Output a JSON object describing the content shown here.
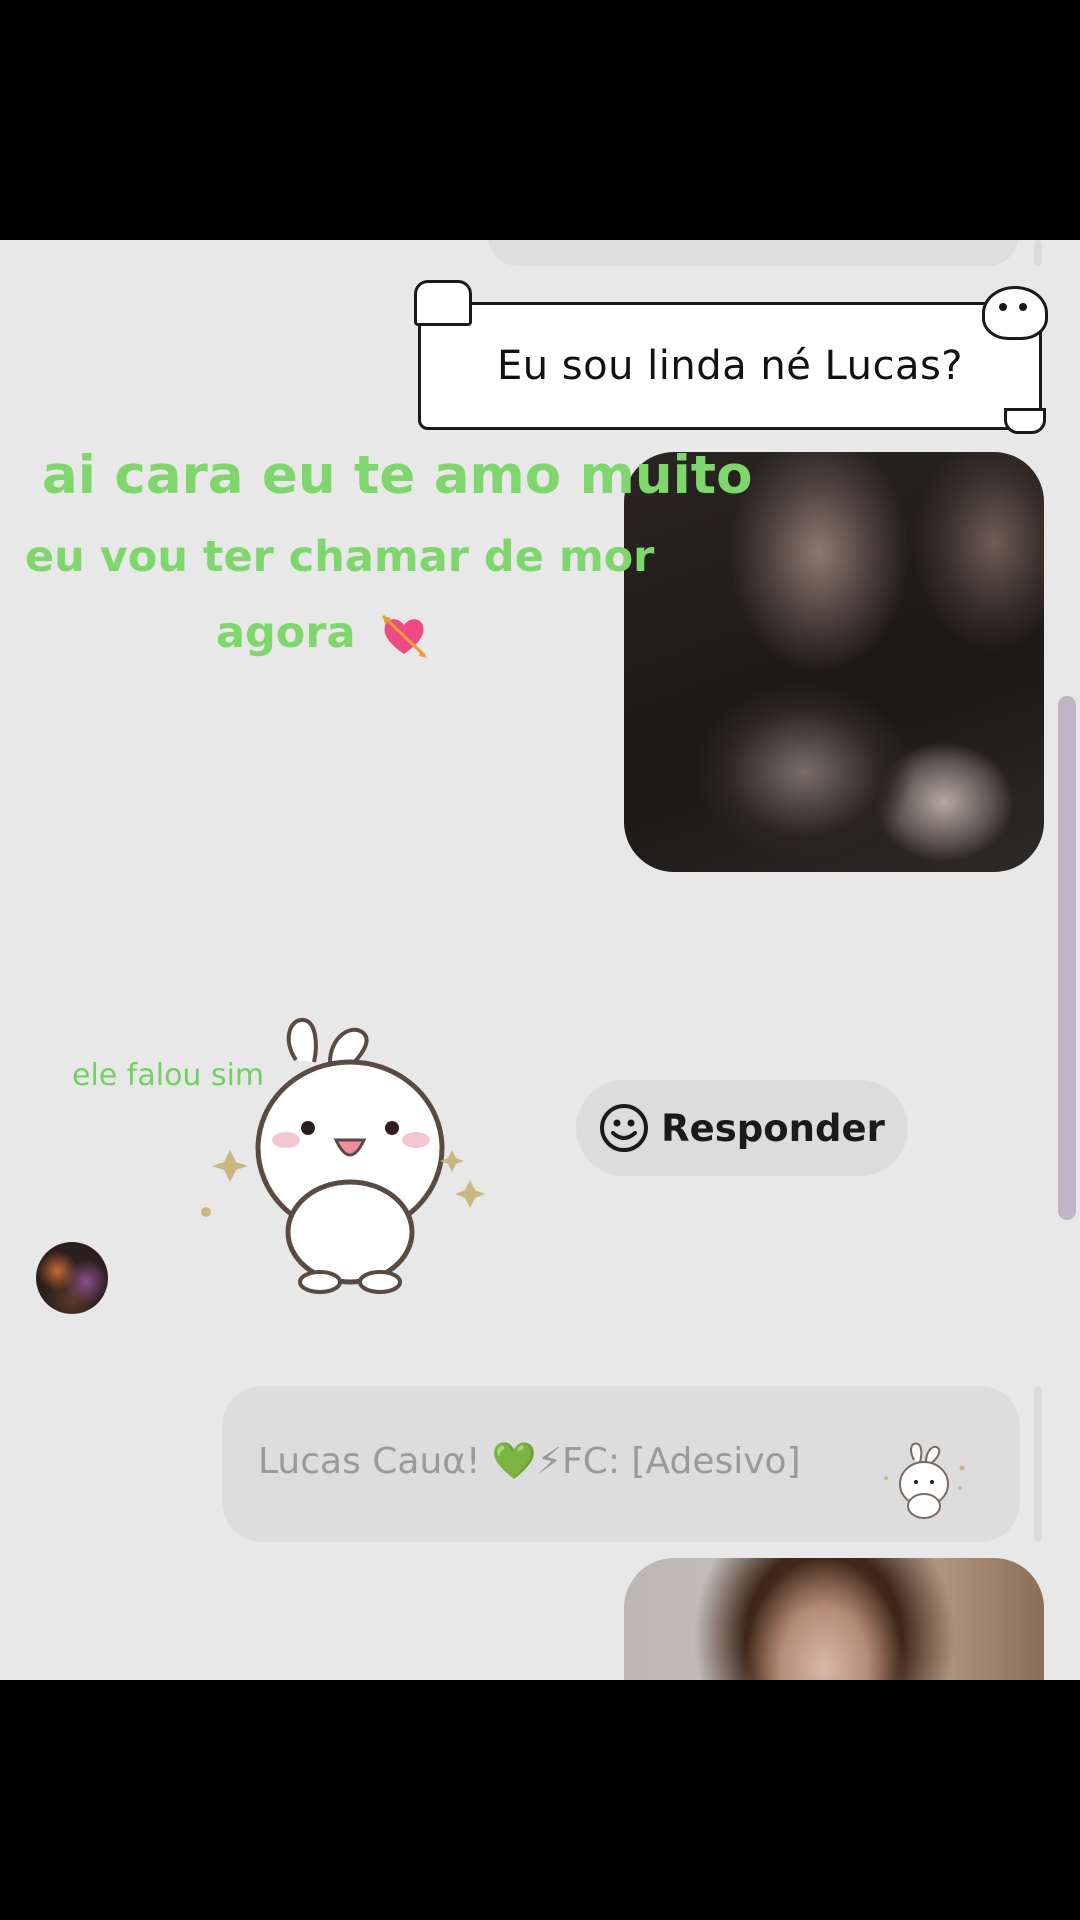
{
  "sticker_message": {
    "text": "Eu sou linda né Lucas?"
  },
  "captions": {
    "line1": "ai cara eu te amo muito",
    "line2": "eu vou ter chamar de mor",
    "line3": "agora",
    "line4": "ele falou sim"
  },
  "actions": {
    "respond_label": "Responder"
  },
  "reply_preview": {
    "text": "Lucas Cauα! 💚⚡FC: [Adesivo]"
  },
  "icons": {
    "heart": "heart-with-arrow-icon",
    "respond": "smiley-face-icon",
    "bunny": "bunny-sticker"
  },
  "colors": {
    "caption_green": "#7ed66d",
    "background": "#e8e8e8",
    "scrollbar": "#c0b5c4"
  }
}
